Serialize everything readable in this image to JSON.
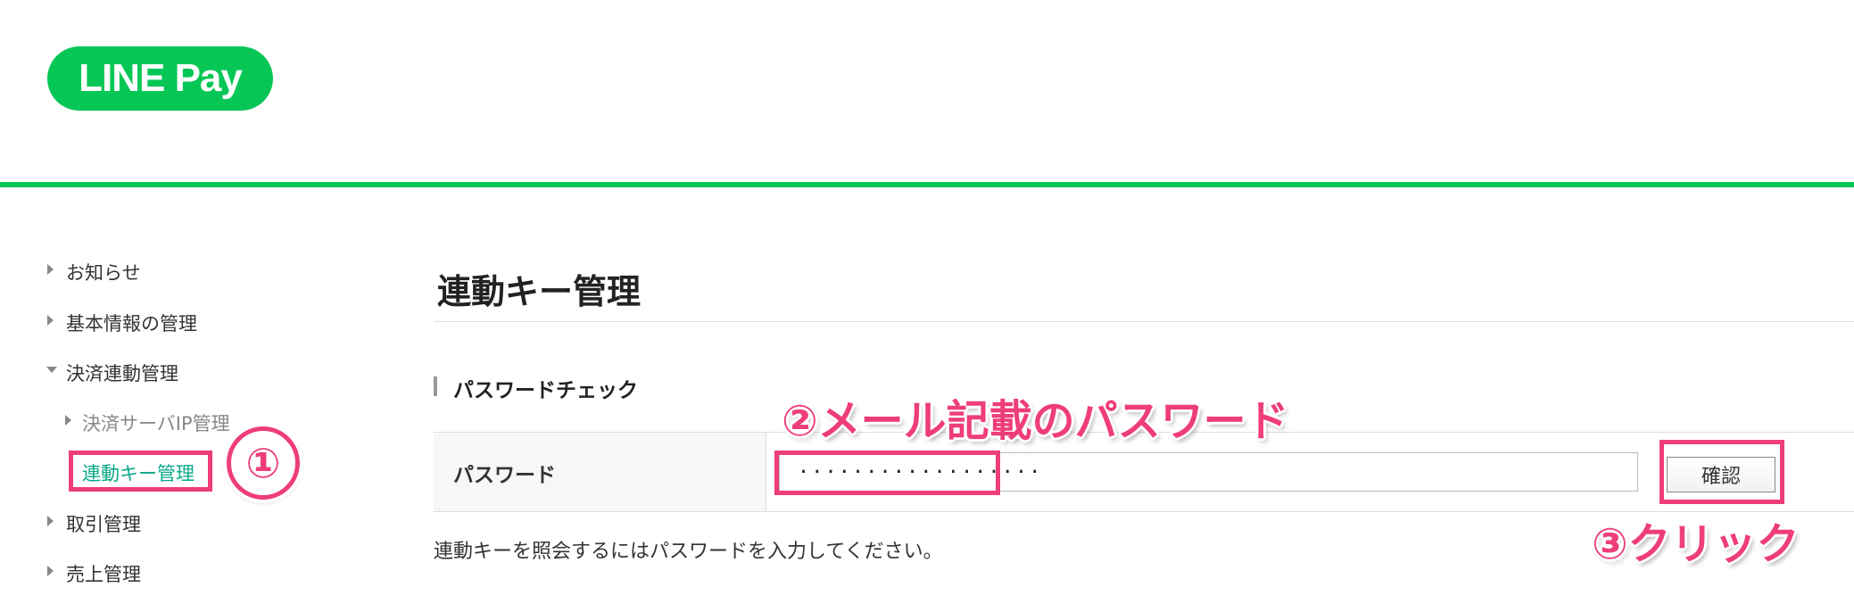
{
  "logo": {
    "text": "LINE Pay"
  },
  "sidebar": {
    "items": [
      {
        "label": "お知らせ"
      },
      {
        "label": "基本情報の管理"
      },
      {
        "label": "決済連動管理"
      },
      {
        "label": "取引管理"
      },
      {
        "label": "売上管理"
      }
    ],
    "sub_items": [
      {
        "label": "決済サーバIP管理"
      },
      {
        "label": "連動キー管理"
      }
    ]
  },
  "main": {
    "page_title": "連動キー管理",
    "section_title": "パスワードチェック",
    "form": {
      "password_label": "パスワード",
      "password_value": "··················",
      "confirm_button": "確認"
    },
    "help_text": "連動キーを照会するにはパスワードを入力してください。"
  },
  "annotations": {
    "step1": "①",
    "step2": "②メール記載のパスワード",
    "step3": "③クリック"
  },
  "colors": {
    "brand_green": "#06c755",
    "annotation_pink": "#ee3d7b",
    "active_link": "#0aa88a"
  }
}
